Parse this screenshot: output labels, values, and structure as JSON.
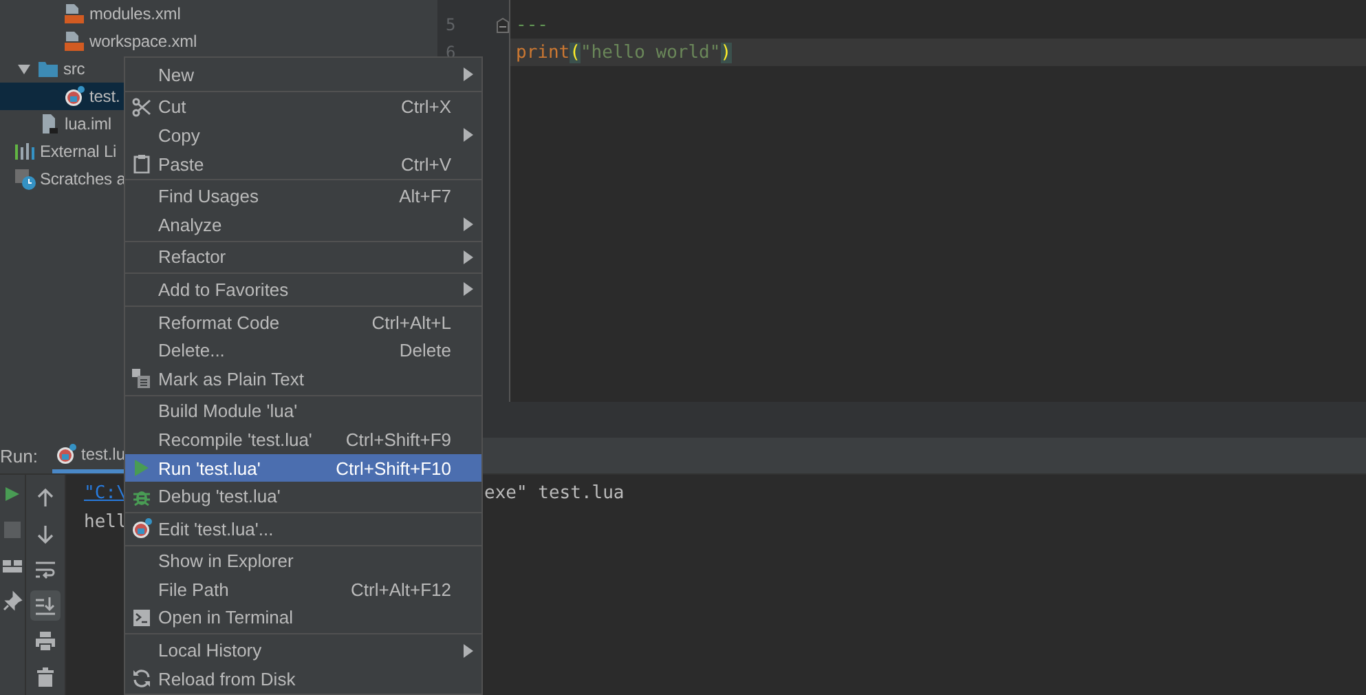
{
  "project_tree": [
    {
      "children": [
        {
          "children": [
            {
              "label": "modules.xml",
              "kind": "xml",
              "selected": false
            },
            {
              "label": "workspace.xml",
              "kind": "xml",
              "selected": false
            }
          ]
        },
        {
          "label": "src",
          "kind": "folder",
          "expanded": true,
          "selected": false,
          "children": [
            {
              "label": "test.",
              "kind": "lua",
              "selected": true
            }
          ]
        },
        {
          "label": "lua.iml",
          "kind": "iml",
          "selected": false
        }
      ]
    },
    {
      "label": "External Li",
      "kind": "library",
      "selected": false
    },
    {
      "label": "Scratches a",
      "kind": "scratch",
      "selected": false
    }
  ],
  "editor": {
    "lines": [
      {
        "number": "5",
        "fold": true,
        "current": false,
        "tokens": [
          {
            "text": "---",
            "kind": "comment"
          }
        ]
      },
      {
        "number": "6",
        "fold": false,
        "current": true,
        "tokens": [
          {
            "text": "print",
            "kind": "keyword"
          },
          {
            "text": "(",
            "kind": "paren"
          },
          {
            "text": "\"hello world\"",
            "kind": "string"
          },
          {
            "text": ")",
            "kind": "paren"
          }
        ]
      }
    ]
  },
  "run_panel": {
    "title": "Run:",
    "tab": {
      "label": "test.lu",
      "selected": true
    },
    "console": [
      {
        "left": "\"C:\\",
        "right": "exe\" test.lua",
        "link": true
      },
      {
        "left": "hell",
        "link": false
      }
    ],
    "right_tools": [
      {
        "kind": "up",
        "on": false
      },
      {
        "kind": "down",
        "on": false
      },
      {
        "kind": "wrap",
        "on": false
      },
      {
        "kind": "scroll-end",
        "on": true
      },
      {
        "kind": "print",
        "on": false
      },
      {
        "kind": "trash",
        "on": false
      }
    ]
  },
  "context_menu": {
    "groups": [
      [
        {
          "label": "New",
          "submenu": true,
          "selected": false
        }
      ],
      [
        {
          "label": "Cut",
          "shortcut": "Ctrl+X",
          "kind": "cut",
          "submenu": false,
          "selected": false
        },
        {
          "label": "Copy",
          "submenu": true,
          "selected": false
        },
        {
          "label": "Paste",
          "shortcut": "Ctrl+V",
          "kind": "paste",
          "submenu": false,
          "selected": false
        }
      ],
      [
        {
          "label": "Find Usages",
          "shortcut": "Alt+F7",
          "submenu": false,
          "selected": false
        },
        {
          "label": "Analyze",
          "submenu": true,
          "selected": false
        }
      ],
      [
        {
          "label": "Refactor",
          "submenu": true,
          "selected": false
        }
      ],
      [
        {
          "label": "Add to Favorites",
          "submenu": true,
          "selected": false
        }
      ],
      [
        {
          "label": "Reformat Code",
          "shortcut": "Ctrl+Alt+L",
          "submenu": false,
          "selected": false
        },
        {
          "label": "Delete...",
          "shortcut": "Delete",
          "submenu": false,
          "selected": false
        },
        {
          "label": "Mark as Plain Text",
          "kind": "plain-text",
          "submenu": false,
          "selected": false
        }
      ],
      [
        {
          "label": "Build Module 'lua'",
          "submenu": false,
          "selected": false
        },
        {
          "label": "Recompile 'test.lua'",
          "shortcut": "Ctrl+Shift+F9",
          "submenu": false,
          "selected": false
        },
        {
          "label": "Run 'test.lua'",
          "shortcut": "Ctrl+Shift+F10",
          "kind": "run",
          "submenu": false,
          "selected": true
        },
        {
          "label": "Debug 'test.lua'",
          "kind": "debug",
          "submenu": false,
          "selected": false
        }
      ],
      [
        {
          "label": "Edit 'test.lua'...",
          "kind": "lua",
          "submenu": false,
          "selected": false
        }
      ],
      [
        {
          "label": "Show in Explorer",
          "submenu": false,
          "selected": false
        },
        {
          "label": "File Path",
          "shortcut": "Ctrl+Alt+F12",
          "submenu": false,
          "selected": false
        },
        {
          "label": "Open in Terminal",
          "kind": "terminal",
          "submenu": false,
          "selected": false
        }
      ],
      [
        {
          "label": "Local History",
          "submenu": true,
          "selected": false
        },
        {
          "label": "Reload from Disk",
          "kind": "reload",
          "submenu": false,
          "selected": false
        }
      ]
    ]
  }
}
